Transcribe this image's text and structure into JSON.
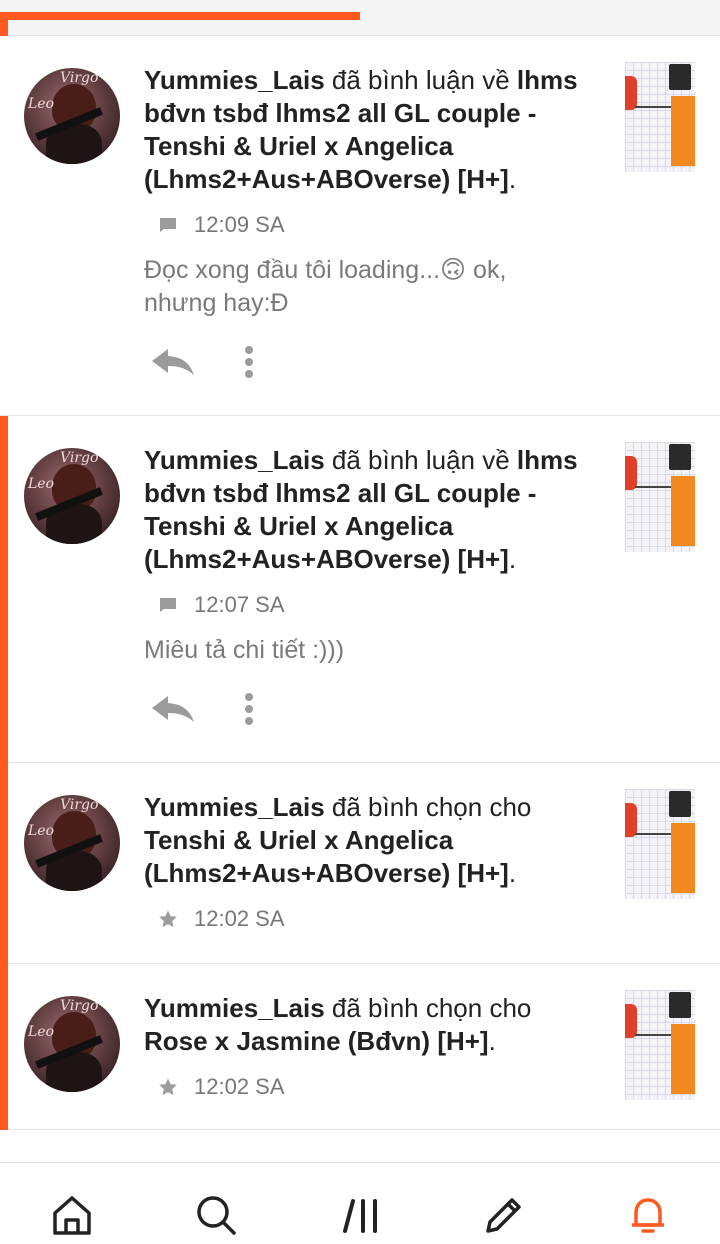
{
  "progress": {
    "fraction": 0.5,
    "color": "#ff5a1f"
  },
  "accent_color": "#ff5a1f",
  "notifications": [
    {
      "user": "Yummies_Lais",
      "action_text": " đã bình luận về ",
      "story": "lhms bđvn tsbđ lhms2 all GL couple - Tenshi & Uriel x Angelica (Lhms2+Aus+ABOverse) [H+]",
      "end_punct": ".",
      "meta_icon": "comment-icon",
      "time": "12:09 SA",
      "comment": "Đọc xong đầu tôi loading...🙃 ok, nhưng hay:Đ",
      "unread": false
    },
    {
      "user": "Yummies_Lais",
      "action_text": " đã bình luận về ",
      "story": "lhms bđvn tsbđ lhms2 all GL couple - Tenshi & Uriel x Angelica (Lhms2+Aus+ABOverse) [H+]",
      "end_punct": ".",
      "meta_icon": "comment-icon",
      "time": "12:07 SA",
      "comment": "Miêu tả chi tiết :)))",
      "unread": true
    },
    {
      "user": "Yummies_Lais",
      "action_text": " đã bình chọn cho ",
      "story": "Tenshi & Uriel x Angelica (Lhms2+Aus+ABOverse) [H+]",
      "end_punct": ".",
      "meta_icon": "star-icon",
      "time": "12:02 SA",
      "unread": true
    },
    {
      "user": "Yummies_Lais",
      "action_text": " đã bình chọn cho ",
      "story": "Rose x Jasmine (Bđvn) [H+]",
      "end_punct": ".",
      "meta_icon": "star-icon",
      "time": "12:02 SA",
      "unread": true
    }
  ],
  "bottom_nav": [
    {
      "icon": "home-icon",
      "active": false
    },
    {
      "icon": "search-icon",
      "active": false
    },
    {
      "icon": "library-icon",
      "active": false
    },
    {
      "icon": "write-icon",
      "active": false
    },
    {
      "icon": "bell-icon",
      "active": true
    }
  ]
}
